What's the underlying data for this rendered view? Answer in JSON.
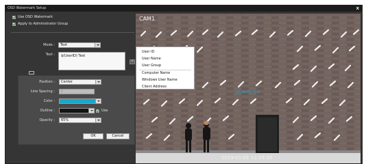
{
  "dialog": {
    "title": "OSD Watermark Setup",
    "close_label": "x"
  },
  "options": {
    "use_osd": {
      "label": "Use OSD Watermark",
      "checked": true
    },
    "apply_admin": {
      "label": "Apply to Administrator Group",
      "checked": true
    }
  },
  "form": {
    "mode_label": "Mode :",
    "mode_value": "Text",
    "text_label": "Text :",
    "text_value": "$(UserID) Test",
    "insert_label": "<",
    "position_label": "Position :",
    "position_value": "Center",
    "line_spacing_label": "Line Spacing :",
    "line_spacing_value": "1",
    "color_label": "Color :",
    "color_value": "#1aa7c9",
    "outline_label": "Outline :",
    "outline_value": "#141414",
    "outline_use_label": "Use",
    "outline_use_checked": true,
    "opacity_label": "Opacity :",
    "opacity_value": "65%"
  },
  "buttons": {
    "ok": "OK",
    "cancel": "Cancel"
  },
  "menu": {
    "items": [
      "User ID",
      "User Name",
      "User Group",
      "Computer Name",
      "Windows User Name",
      "Client Address"
    ]
  },
  "preview": {
    "camera_label": "CAM1",
    "watermark": "$(UserID) Test",
    "timestamp": "2019-01-01 12:05:30"
  }
}
